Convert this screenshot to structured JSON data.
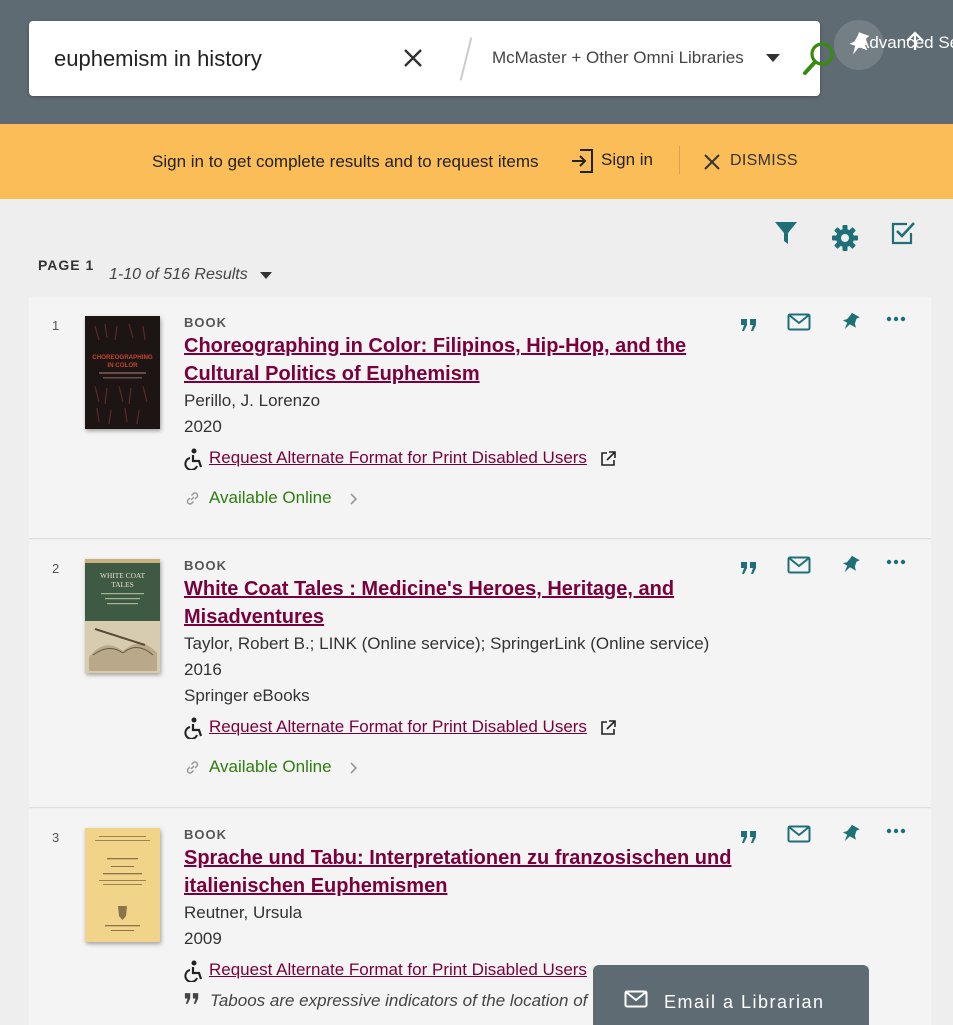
{
  "search": {
    "query": "euphemism in history",
    "scope": "McMaster + Other Omni Libraries",
    "advanced_label": "Advanced Se"
  },
  "banner": {
    "message": "Sign in to get complete results and to request items",
    "signin_label": "Sign in",
    "dismiss_label": "DISMISS"
  },
  "toolbar": {
    "page_label": "PAGE 1",
    "results_count": "1-10 of 516 Results"
  },
  "colors": {
    "header_bg": "#5f6b73",
    "banner_bg": "#fbbd58",
    "title_link": "#7a003c",
    "icon_teal": "#1f6f78",
    "available_green": "#2e7d0f"
  },
  "results": [
    {
      "number": "1",
      "type": "BOOK",
      "title": "Choreographing in Color: Filipinos, Hip-Hop, and the Cultural Politics of Euphemism",
      "author": "Perillo, J. Lorenzo",
      "year": "2020",
      "alt_format": "Request Alternate Format for Print Disabled Users",
      "availability": "Available Online",
      "cover_text": "CHOREOGRAPHING IN COLOR"
    },
    {
      "number": "2",
      "type": "BOOK",
      "title": "White Coat Tales : Medicine's Heroes, Heritage, and Misadventures",
      "author": "Taylor, Robert B.; LINK (Online service); SpringerLink (Online service)",
      "year": "2016",
      "publisher": "Springer eBooks",
      "alt_format": "Request Alternate Format for Print Disabled Users",
      "availability": "Available Online",
      "cover_text": "WHITE COAT TALES"
    },
    {
      "number": "3",
      "type": "BOOK",
      "title": "Sprache und Tabu: Interpretationen zu franzosischen und italienischen Euphemismen",
      "author": "Reutner, Ursula",
      "year": "2009",
      "alt_format": "Request Alternate Format for Print Disabled Users",
      "snippet": "Taboos are expressive indicators of the location of"
    }
  ],
  "chat": {
    "label": "Email a Librarian"
  },
  "icons": [
    "clear-icon",
    "search-icon",
    "pin-icon",
    "upload-arrow-icon",
    "sign-in-icon",
    "close-icon",
    "filter-icon",
    "gear-icon",
    "checkbox-icon",
    "quote-icon",
    "email-icon",
    "more-icon",
    "accessibility-icon",
    "external-link-icon",
    "link-icon",
    "chevron-right-icon"
  ]
}
